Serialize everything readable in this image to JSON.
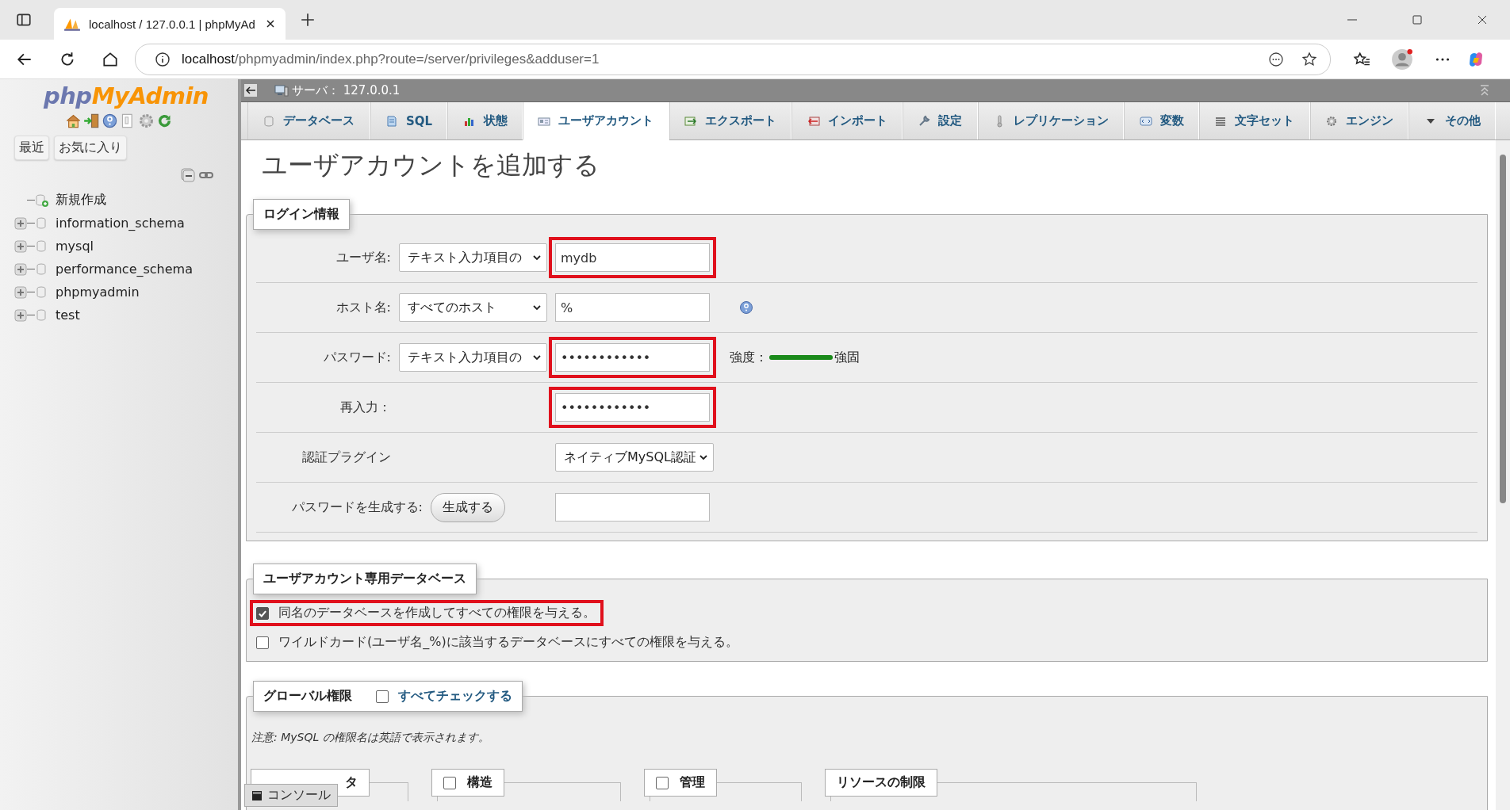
{
  "browser": {
    "tab_title": "localhost / 127.0.0.1 | phpMyAd",
    "url_host": "localhost",
    "url_path": "/phpmyadmin/index.php?route=/server/privileges&adduser=1"
  },
  "sidebar": {
    "logo_first": "php",
    "logo_second": "MyAdmin",
    "buttons": [
      "最近",
      "お気に入り"
    ],
    "tree": [
      {
        "label": "新規作成",
        "kind": "new"
      },
      {
        "label": "information_schema",
        "kind": "db"
      },
      {
        "label": "mysql",
        "kind": "db"
      },
      {
        "label": "performance_schema",
        "kind": "db"
      },
      {
        "label": "phpmyadmin",
        "kind": "db"
      },
      {
        "label": "test",
        "kind": "db"
      }
    ]
  },
  "breadcrumb": "サーバ： 127.0.0.1",
  "tabs": [
    {
      "label": "データベース",
      "kind": "db",
      "selected": false
    },
    {
      "label": "SQL",
      "kind": "sql",
      "selected": false
    },
    {
      "label": "状態",
      "kind": "status",
      "selected": false
    },
    {
      "label": "ユーザアカウント",
      "kind": "users",
      "selected": true
    },
    {
      "label": "エクスポート",
      "kind": "export",
      "selected": false
    },
    {
      "label": "インポート",
      "kind": "import",
      "selected": false
    },
    {
      "label": "設定",
      "kind": "settings",
      "selected": false
    },
    {
      "label": "レプリケーション",
      "kind": "replication",
      "selected": false
    },
    {
      "label": "変数",
      "kind": "vars",
      "selected": false
    },
    {
      "label": "文字セット",
      "kind": "charset",
      "selected": false
    },
    {
      "label": "エンジン",
      "kind": "engine",
      "selected": false
    },
    {
      "label": "その他",
      "kind": "more",
      "selected": false
    }
  ],
  "page_title": "ユーザアカウントを追加する",
  "login": {
    "legend": "ログイン情報",
    "rows": [
      {
        "kind": "select_input",
        "label": "ユーザ名:",
        "select": "テキスト入力項目の",
        "input": "mydb",
        "highlighted": true
      },
      {
        "kind": "select_input",
        "label": "ホスト名:",
        "select": "すべてのホスト",
        "input": "%",
        "highlighted": false,
        "help": true
      },
      {
        "kind": "select_input",
        "label": "パスワード:",
        "select": "テキスト入力項目の",
        "input": "••••••••••••",
        "highlighted": true,
        "strength": {
          "label": "強度：",
          "level": 1,
          "text": "強固"
        }
      },
      {
        "kind": "input",
        "label": "再入力：",
        "input": "••••••••••••",
        "highlighted": true
      },
      {
        "kind": "plugin",
        "label": "認証プラグイン",
        "select": "ネイティブMySQL認証"
      },
      {
        "kind": "generate",
        "label": "パスワードを生成する:",
        "button": "生成する",
        "input": "",
        "highlighted": false
      }
    ]
  },
  "database": {
    "legend": "ユーザアカウント専用データベース",
    "options": [
      {
        "label": "同名のデータベースを作成してすべての権限を与える。",
        "checked": true,
        "highlighted": true
      },
      {
        "label": "ワイルドカード(ユーザ名_%)に該当するデータベースにすべての権限を与える。",
        "checked": false,
        "highlighted": false
      }
    ]
  },
  "global": {
    "legend": "グローバル権限",
    "check_all": {
      "label": "すべてチェックする",
      "checked": false
    },
    "note": "注意: MySQL の権限名は英語で表示されます。",
    "groups": [
      {
        "kind": "plain",
        "legend": "タ"
      },
      {
        "kind": "checkbox",
        "legend": "構造",
        "checked": false
      },
      {
        "kind": "checkbox",
        "legend": "管理",
        "checked": false
      },
      {
        "kind": "plain",
        "legend": "リソースの制限"
      }
    ]
  },
  "console": "コンソール"
}
